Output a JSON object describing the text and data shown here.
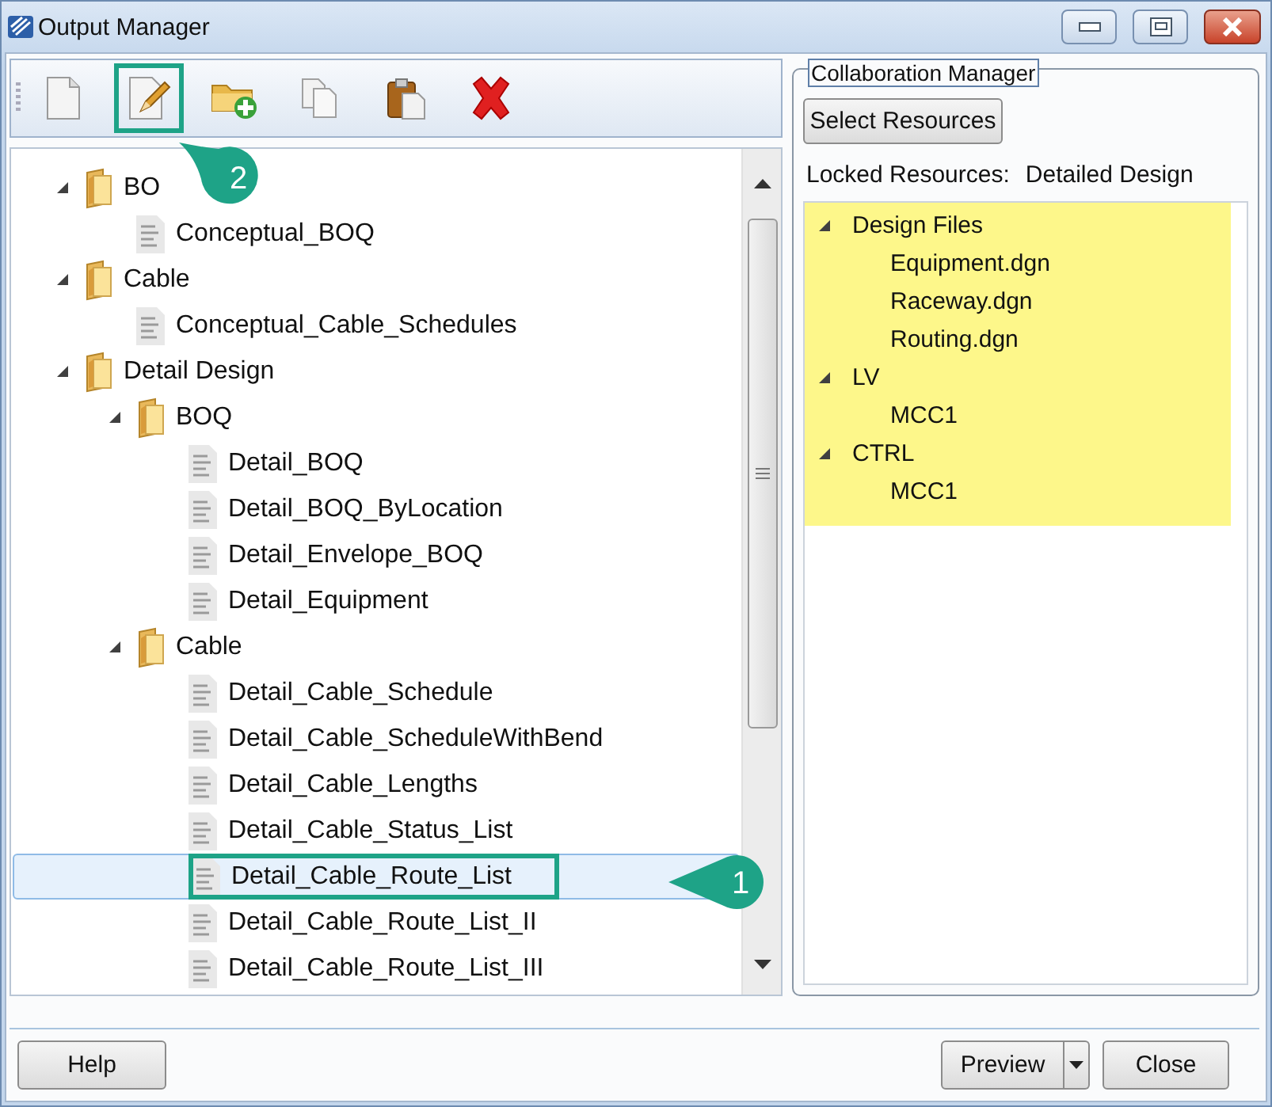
{
  "window": {
    "title": "Output Manager"
  },
  "toolbar": {
    "buttons": [
      {
        "kind": "new",
        "highlighted": false
      },
      {
        "kind": "edit",
        "highlighted": true
      },
      {
        "kind": "new-folder",
        "highlighted": false
      },
      {
        "kind": "copy",
        "highlighted": false
      },
      {
        "kind": "paste",
        "highlighted": false
      },
      {
        "kind": "delete",
        "highlighted": false
      }
    ]
  },
  "output_tree": {
    "items": [
      {
        "children": [
          {
            "label": "BO",
            "kind": "folder",
            "expanded": true,
            "selected": false,
            "highlighted": false,
            "children": [
              {
                "label": "Conceptual_BOQ",
                "kind": "report",
                "selected": false,
                "highlighted": false
              }
            ]
          },
          {
            "label": "Cable",
            "kind": "folder",
            "expanded": true,
            "selected": false,
            "highlighted": false,
            "children": [
              {
                "label": "Conceptual_Cable_Schedules",
                "kind": "report",
                "selected": false,
                "highlighted": false
              }
            ]
          }
        ]
      },
      {
        "label": "Detail Design",
        "kind": "folder",
        "expanded": true,
        "selected": false,
        "highlighted": false,
        "children": [
          {
            "label": "BOQ",
            "kind": "folder",
            "expanded": true,
            "selected": false,
            "highlighted": false,
            "children": [
              {
                "label": "Detail_BOQ",
                "kind": "report",
                "selected": false,
                "highlighted": false
              },
              {
                "label": "Detail_BOQ_ByLocation",
                "kind": "report",
                "selected": false,
                "highlighted": false
              },
              {
                "label": "Detail_Envelope_BOQ",
                "kind": "report",
                "selected": false,
                "highlighted": false
              },
              {
                "label": "Detail_Equipment",
                "kind": "report",
                "selected": false,
                "highlighted": false
              }
            ]
          },
          {
            "label": "Cable",
            "kind": "folder",
            "expanded": true,
            "selected": false,
            "highlighted": false,
            "children": [
              {
                "label": "Detail_Cable_Schedule",
                "kind": "report",
                "selected": false,
                "highlighted": false
              },
              {
                "label": "Detail_Cable_ScheduleWithBend",
                "kind": "report",
                "selected": false,
                "highlighted": false
              },
              {
                "label": "Detail_Cable_Lengths",
                "kind": "report",
                "selected": false,
                "highlighted": false
              },
              {
                "label": "Detail_Cable_Status_List",
                "kind": "report",
                "selected": false,
                "highlighted": false
              },
              {
                "label": "Detail_Cable_Route_List",
                "kind": "report",
                "selected": true,
                "highlighted": true
              },
              {
                "label": "Detail_Cable_Route_List_II",
                "kind": "report",
                "selected": false,
                "highlighted": false
              },
              {
                "label": "Detail_Cable_Route_List_III",
                "kind": "report",
                "selected": false,
                "highlighted": false
              }
            ]
          }
        ]
      }
    ]
  },
  "collaboration": {
    "title": "Collaboration Manager",
    "select_button": "Select Resources",
    "locked_label": "Locked Resources:",
    "locked_value": "Detailed Design",
    "resources": [
      {
        "label": "Design Files",
        "expanded": true,
        "children": [
          {
            "label": "Equipment.dgn"
          },
          {
            "label": "Raceway.dgn"
          },
          {
            "label": "Routing.dgn"
          }
        ]
      },
      {
        "label": "LV",
        "expanded": true,
        "children": [
          {
            "label": "MCC1"
          }
        ]
      },
      {
        "label": "CTRL",
        "expanded": true,
        "children": [
          {
            "label": "MCC1"
          }
        ]
      }
    ]
  },
  "callouts": [
    "2",
    "1"
  ],
  "footer": {
    "help": "Help",
    "preview": "Preview",
    "close": "Close"
  }
}
